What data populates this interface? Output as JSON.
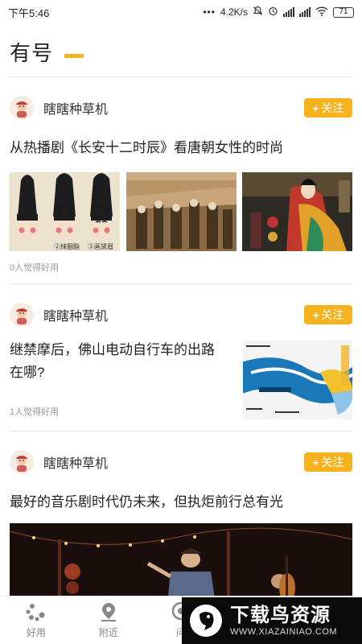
{
  "status_bar": {
    "time": "下午5:46",
    "network_speed": "4.2K/s",
    "battery": "71"
  },
  "header": {
    "title": "有号"
  },
  "feed": [
    {
      "author": "瞎瞎种草机",
      "follow_label": "关注",
      "title": "从热播剧《长安十二时辰》看唐朝女性的时尚",
      "likes": "0人觉得好用",
      "image_captions": [
        "②抹胭脂",
        "③画黛眉"
      ]
    },
    {
      "author": "瞎瞎种草机",
      "follow_label": "关注",
      "title": "继禁摩后，佛山电动自行车的出路在哪?",
      "likes": "1人觉得好用"
    },
    {
      "author": "瞎瞎种草机",
      "follow_label": "关注",
      "title": "最好的音乐剧时代仍未来，但执炬前行总有光"
    }
  ],
  "bottom_nav": {
    "items": [
      {
        "label": "好用",
        "icon": "dots-cluster-icon"
      },
      {
        "label": "附近",
        "icon": "location-pin-icon"
      },
      {
        "label": "问",
        "icon": "question-bubble-icon"
      }
    ]
  },
  "watermark": {
    "name": "下载鸟资源",
    "url": "WWW.XIAZAINIAO.COM"
  },
  "colors": {
    "accent": "#f7b21e",
    "divider": "#e6e6e6",
    "muted_text": "#999999"
  }
}
